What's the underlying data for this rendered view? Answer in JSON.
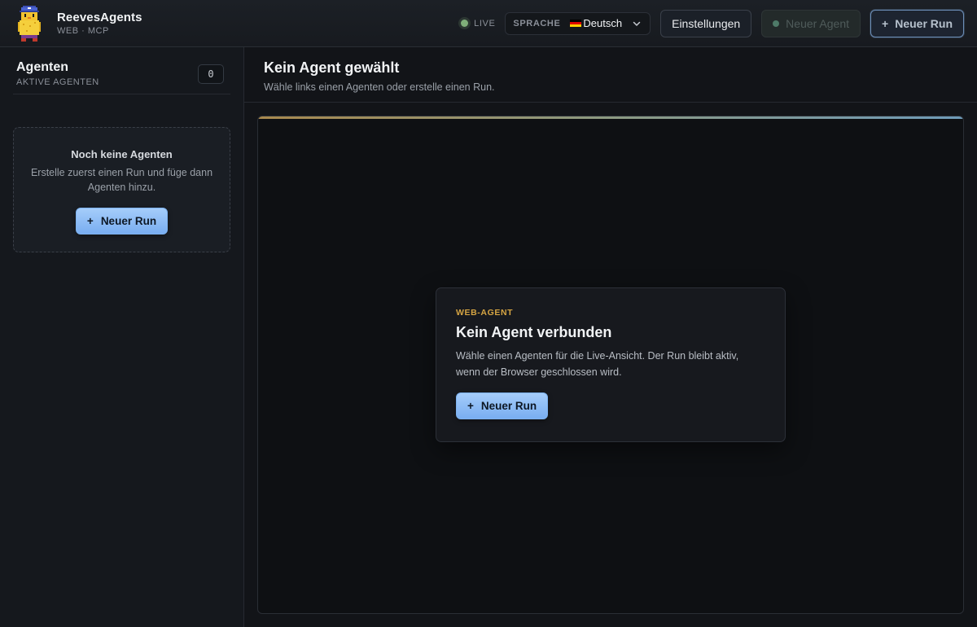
{
  "header": {
    "brand_title": "ReevesAgents",
    "brand_sub": "WEB · MCP",
    "live_label": "LIVE",
    "language_label": "SPRACHE",
    "language_value": "Deutsch",
    "settings_label": "Einstellungen",
    "new_agent_label": "Neuer Agent",
    "new_run_label": "Neuer Run",
    "colors": {
      "live": "#7fae79",
      "accent_blue": "#79aef1"
    }
  },
  "sidebar": {
    "title": "Agenten",
    "subtitle": "AKTIVE AGENTEN",
    "count": "0",
    "empty_title": "Noch keine Agenten",
    "empty_text": "Erstelle zuerst einen Run und füge dann Agenten hinzu.",
    "new_run_label": "Neuer Run"
  },
  "main": {
    "title": "Kein Agent gewählt",
    "subtitle": "Wähle links einen Agenten oder erstelle einen Run.",
    "card": {
      "eyebrow": "WEB-AGENT",
      "title": "Kein Agent verbunden",
      "text": "Wähle einen Agenten für die Live-Ansicht. Der Run bleibt aktiv, wenn der Browser geschlossen wird.",
      "button_label": "Neuer Run"
    }
  },
  "icons": {
    "mascot": "pixel-chick-mascot-icon",
    "chevron": "chevron-down-icon",
    "plus": "plus-icon",
    "flag": "german-flag-icon"
  }
}
